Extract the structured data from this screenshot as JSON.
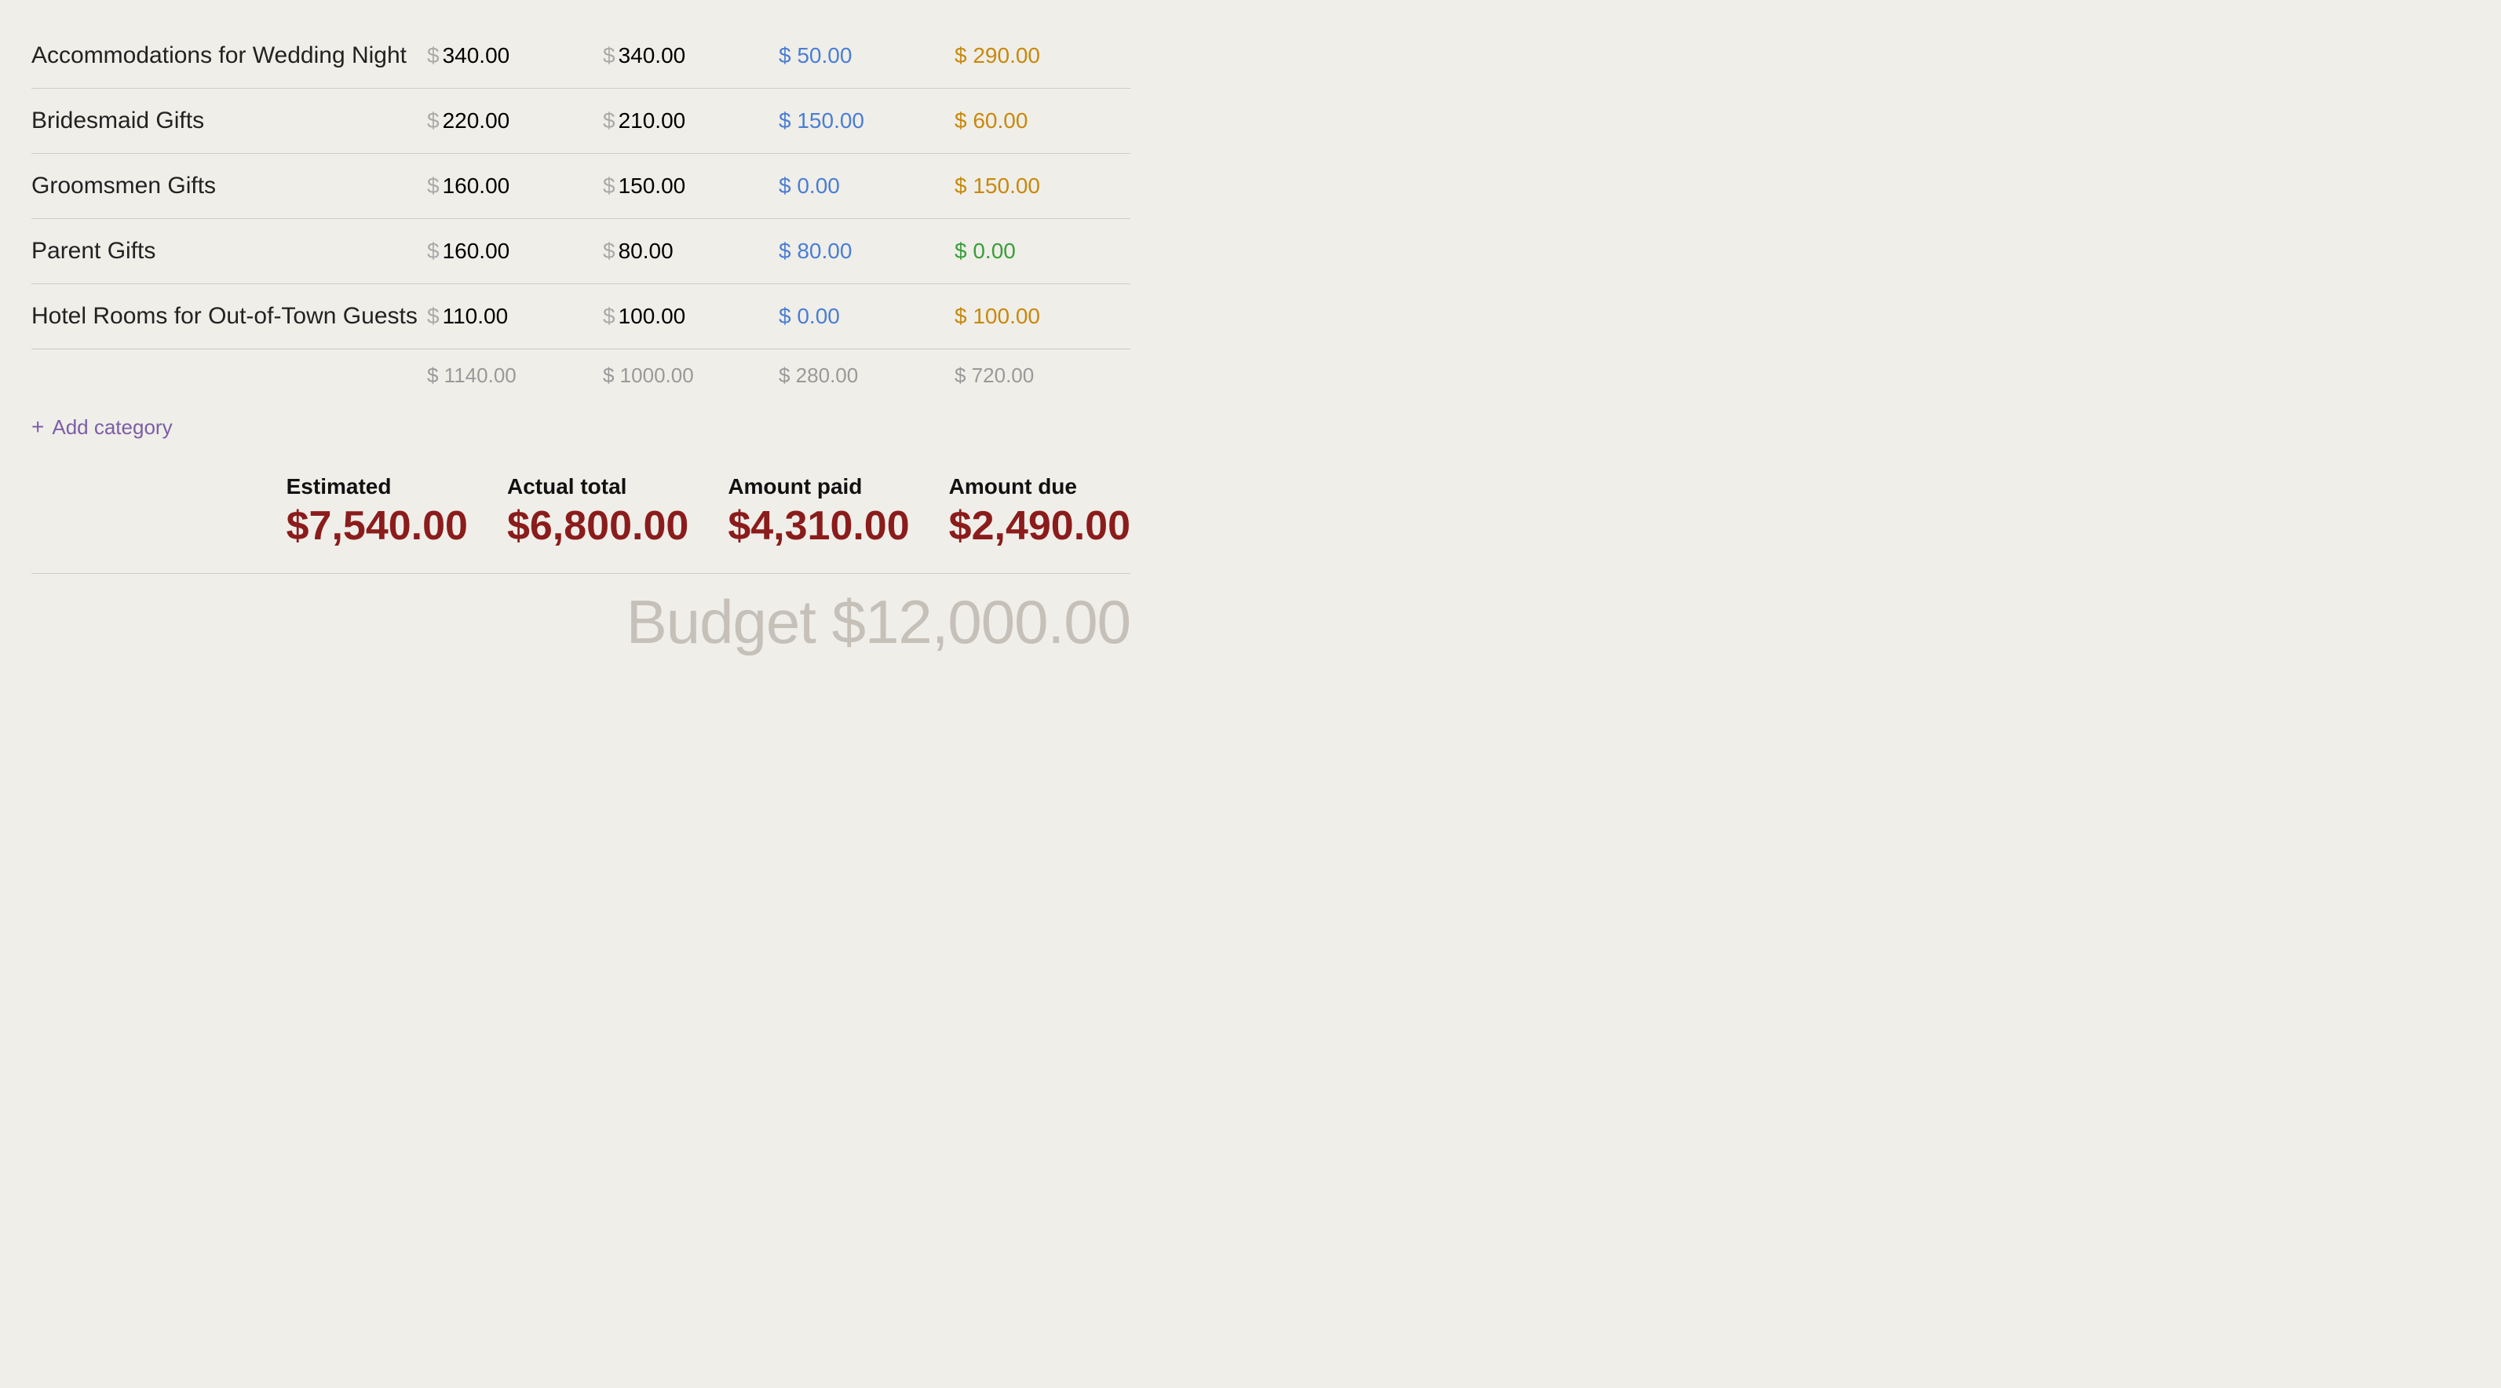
{
  "table": {
    "rows": [
      {
        "name": "Accommodations for Wedding Night",
        "estimated": "340.00",
        "actual": "340.00",
        "paid": "50.00",
        "due": "290.00",
        "due_zero": false
      },
      {
        "name": "Bridesmaid Gifts",
        "estimated": "220.00",
        "actual": "210.00",
        "paid": "150.00",
        "due": "60.00",
        "due_zero": false
      },
      {
        "name": "Groomsmen Gifts",
        "estimated": "160.00",
        "actual": "150.00",
        "paid": "0.00",
        "due": "150.00",
        "due_zero": false
      },
      {
        "name": "Parent Gifts",
        "estimated": "160.00",
        "actual": "80.00",
        "paid": "80.00",
        "due": "0.00",
        "due_zero": true
      },
      {
        "name": "Hotel Rooms for Out-of-Town Guests",
        "estimated": "110.00",
        "actual": "100.00",
        "paid": "0.00",
        "due": "100.00",
        "due_zero": false
      }
    ],
    "subtotals": {
      "estimated": "$ 1140.00",
      "actual": "$ 1000.00",
      "paid": "$ 280.00",
      "due": "$ 720.00"
    },
    "add_category_label": "Add category"
  },
  "summary": {
    "columns": [
      {
        "label": "Estimated",
        "value": "$7,540.00"
      },
      {
        "label": "Actual total",
        "value": "$6,800.00"
      },
      {
        "label": "Amount paid",
        "value": "$4,310.00"
      },
      {
        "label": "Amount due",
        "value": "$2,490.00"
      }
    ]
  },
  "budget": {
    "label": "Budget",
    "value": "$12,000.00"
  },
  "icons": {
    "dollar": "$",
    "plus": "+"
  }
}
